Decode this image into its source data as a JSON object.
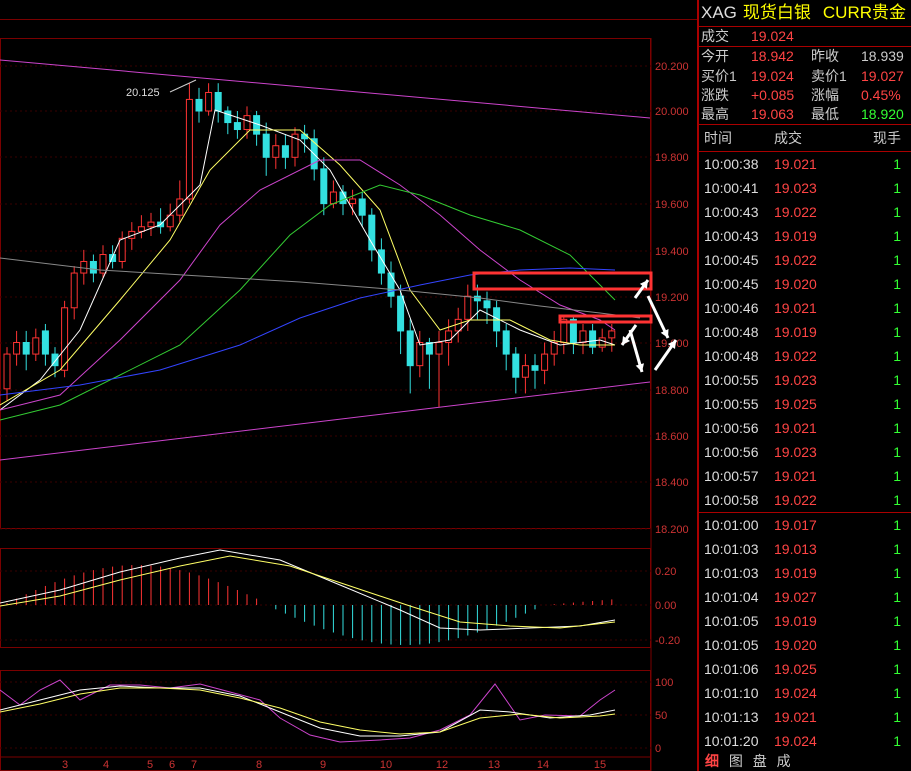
{
  "chart": {
    "y_labels": [
      "20.200",
      "20.000",
      "19.800",
      "19.600",
      "19.400",
      "19.200",
      "19.000",
      "18.800",
      "18.600",
      "18.400",
      "18.200"
    ],
    "x_labels": [
      "3",
      "4",
      "5",
      "6",
      "7",
      "8",
      "9",
      "10",
      "12",
      "13",
      "14",
      "15"
    ],
    "peak_label": "20.125",
    "macd_labels": [
      "0.20",
      "0.00",
      "-0.20"
    ],
    "kdj_labels": [
      "100",
      "50",
      "0"
    ]
  },
  "quote": {
    "code": "XAG",
    "name": "现货白银",
    "category": "CURR贵金",
    "deal_label": "成交",
    "deal_value": "19.024",
    "open_label": "今开",
    "open_value": "18.942",
    "prev_label": "昨收",
    "prev_value": "18.939",
    "bid_label": "买价1",
    "bid_value": "19.024",
    "ask_label": "卖价1",
    "ask_value": "19.027",
    "chg_label": "涨跌",
    "chg_value": "+0.085",
    "pct_label": "涨幅",
    "pct_value": "0.45%",
    "high_label": "最高",
    "high_value": "19.063",
    "low_label": "最低",
    "low_value": "18.920"
  },
  "ticks_header": {
    "time": "时间",
    "price": "成交",
    "vol": "现手"
  },
  "ticks": [
    {
      "time": "10:00:38",
      "price": "19.021",
      "vol": "1"
    },
    {
      "time": "10:00:41",
      "price": "19.023",
      "vol": "1"
    },
    {
      "time": "10:00:43",
      "price": "19.022",
      "vol": "1"
    },
    {
      "time": "10:00:43",
      "price": "19.019",
      "vol": "1"
    },
    {
      "time": "10:00:45",
      "price": "19.022",
      "vol": "1"
    },
    {
      "time": "10:00:45",
      "price": "19.020",
      "vol": "1"
    },
    {
      "time": "10:00:46",
      "price": "19.021",
      "vol": "1"
    },
    {
      "time": "10:00:48",
      "price": "19.019",
      "vol": "1"
    },
    {
      "time": "10:00:48",
      "price": "19.022",
      "vol": "1"
    },
    {
      "time": "10:00:55",
      "price": "19.023",
      "vol": "1"
    },
    {
      "time": "10:00:55",
      "price": "19.025",
      "vol": "1"
    },
    {
      "time": "10:00:56",
      "price": "19.021",
      "vol": "1"
    },
    {
      "time": "10:00:56",
      "price": "19.023",
      "vol": "1"
    },
    {
      "time": "10:00:57",
      "price": "19.021",
      "vol": "1"
    },
    {
      "time": "10:00:58",
      "price": "19.022",
      "vol": "1"
    },
    {
      "time": "10:01:00",
      "price": "19.017",
      "vol": "1"
    },
    {
      "time": "10:01:03",
      "price": "19.013",
      "vol": "1"
    },
    {
      "time": "10:01:03",
      "price": "19.019",
      "vol": "1"
    },
    {
      "time": "10:01:04",
      "price": "19.027",
      "vol": "1"
    },
    {
      "time": "10:01:05",
      "price": "19.019",
      "vol": "1"
    },
    {
      "time": "10:01:05",
      "price": "19.020",
      "vol": "1"
    },
    {
      "time": "10:01:06",
      "price": "19.025",
      "vol": "1"
    },
    {
      "time": "10:01:10",
      "price": "19.024",
      "vol": "1"
    },
    {
      "time": "10:01:13",
      "price": "19.021",
      "vol": "1"
    },
    {
      "time": "10:01:20",
      "price": "19.024",
      "vol": "1"
    }
  ],
  "tabs": [
    "细",
    "图",
    "盘",
    "成"
  ],
  "colors": {
    "up": "#ff3333",
    "down": "#33e0e0",
    "grid": "#8b0000",
    "text_red": "#ff4444",
    "text_green": "#33ff33"
  }
}
